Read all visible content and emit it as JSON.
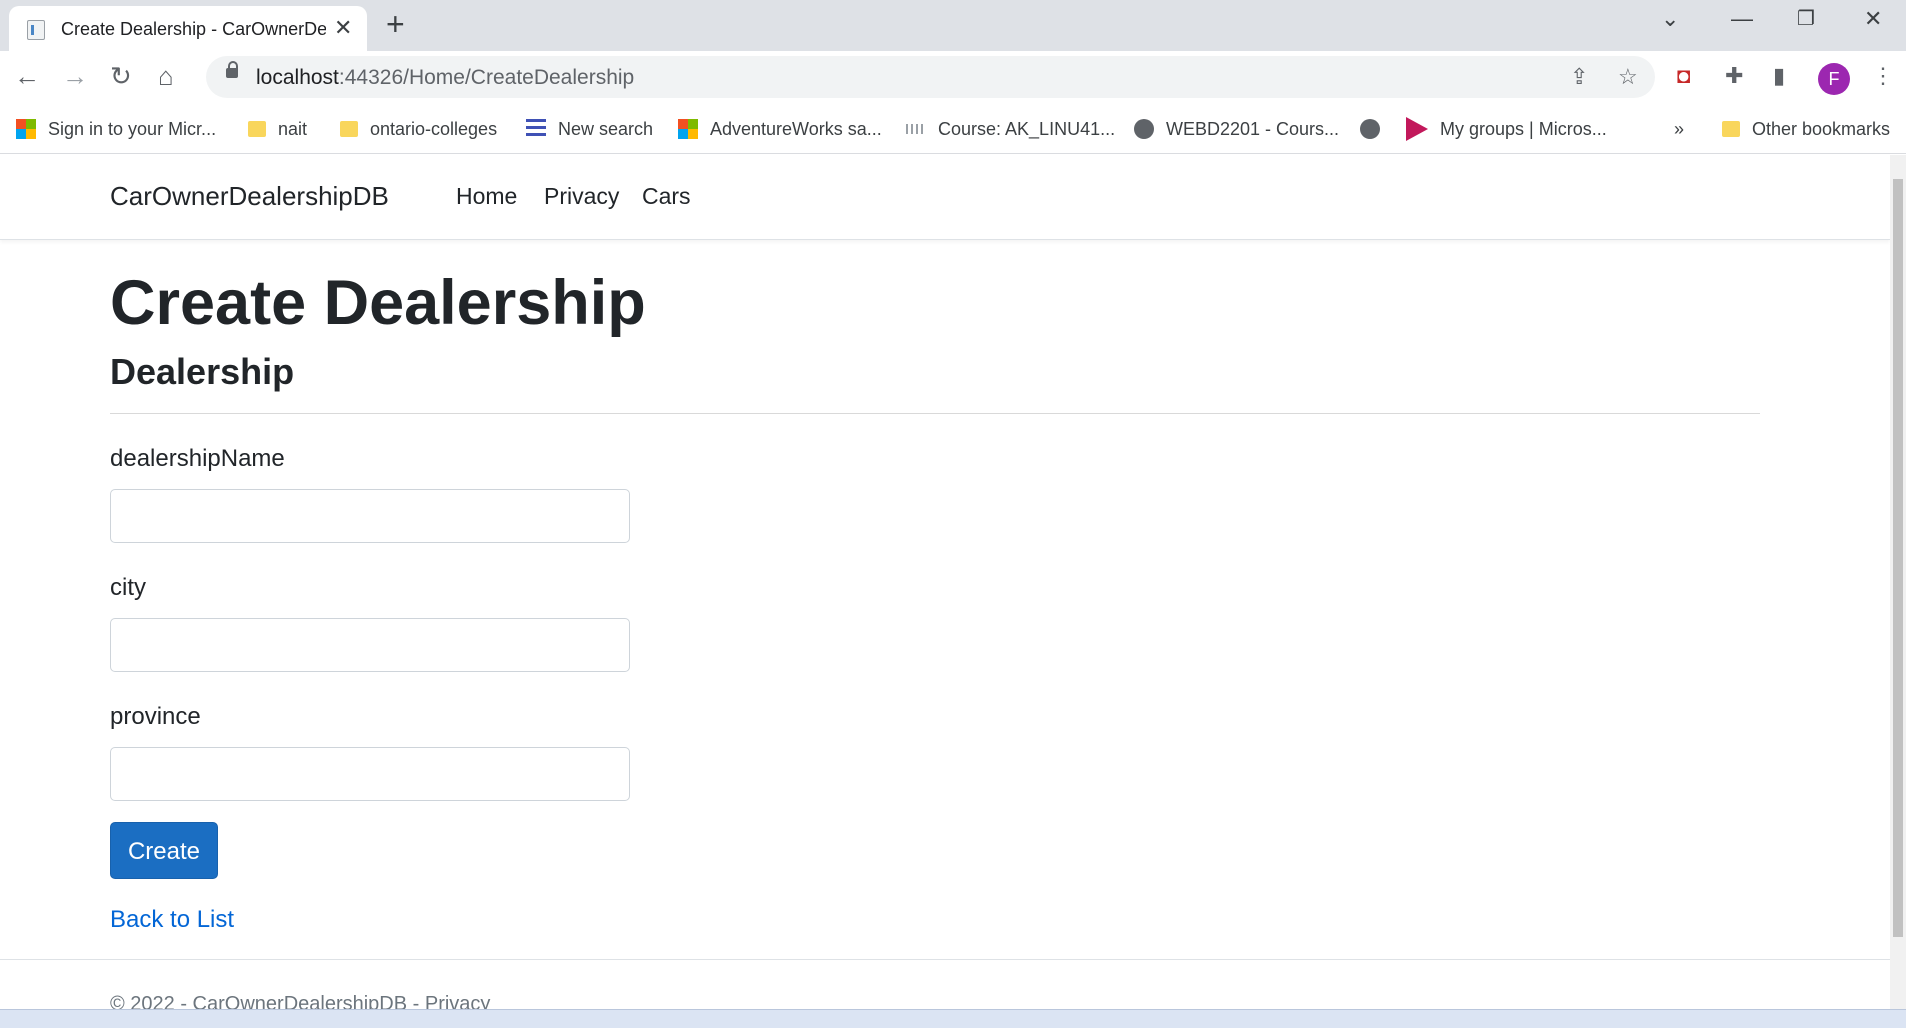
{
  "browser": {
    "tab_title": "Create Dealership - CarOwnerDealershipDB",
    "url_host": "localhost",
    "url_rest": ":44326/Home/CreateDealership",
    "profile_initial": "F",
    "bookmarks": [
      {
        "label": "Sign in to your Micr...",
        "icon": "microsoft-icon"
      },
      {
        "label": "nait",
        "icon": "folder-icon"
      },
      {
        "label": "ontario-colleges",
        "icon": "folder-icon"
      },
      {
        "label": "New search",
        "icon": "search-lines-icon"
      },
      {
        "label": "AdventureWorks sa...",
        "icon": "microsoft-icon"
      },
      {
        "label": "Course: AK_LINU41...",
        "icon": "cisco-icon"
      },
      {
        "label": "WEBD2201 - Cours...",
        "icon": "globe-icon"
      },
      {
        "label": "",
        "icon": "globe-icon"
      },
      {
        "label": "My groups | Micros...",
        "icon": "arrow-icon"
      }
    ],
    "more_bookmarks": "»",
    "other_bookmarks": "Other bookmarks"
  },
  "navbar": {
    "brand": "CarOwnerDealershipDB",
    "links": [
      "Home",
      "Privacy",
      "Cars"
    ]
  },
  "main": {
    "title": "Create Dealership",
    "subtitle": "Dealership",
    "fields": [
      {
        "label": "dealershipName",
        "value": ""
      },
      {
        "label": "city",
        "value": ""
      },
      {
        "label": "province",
        "value": ""
      }
    ],
    "submit_label": "Create",
    "back_link": "Back to List"
  },
  "footer": {
    "text": "© 2022 - CarOwnerDealershipDB - Privacy"
  }
}
